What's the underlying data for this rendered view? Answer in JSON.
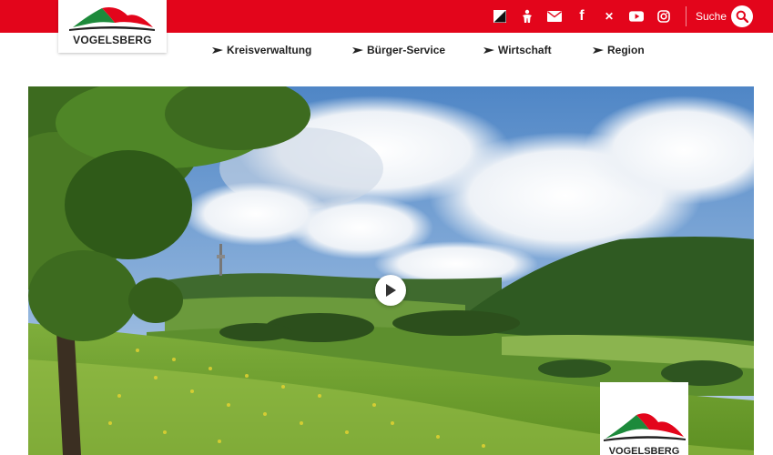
{
  "brand": {
    "logo_text": "VOGELSBERG",
    "red": "#e3051b",
    "green": "#1d8a3b"
  },
  "topbar": {
    "icons": [
      "contrast-icon",
      "accessibility-icon",
      "mail-icon",
      "facebook-icon",
      "x-icon",
      "youtube-icon",
      "instagram-icon"
    ],
    "x_glyph": "✕",
    "facebook_glyph": "f",
    "search_label": "Suche"
  },
  "nav": {
    "items": [
      {
        "label": "Kreisverwaltung"
      },
      {
        "label": "Bürger-Service"
      },
      {
        "label": "Wirtschaft"
      },
      {
        "label": "Region"
      }
    ]
  },
  "hero": {
    "media": "landscape-video",
    "play_icon": "play-icon"
  },
  "badge": {
    "text": "VOGELSBERG"
  }
}
